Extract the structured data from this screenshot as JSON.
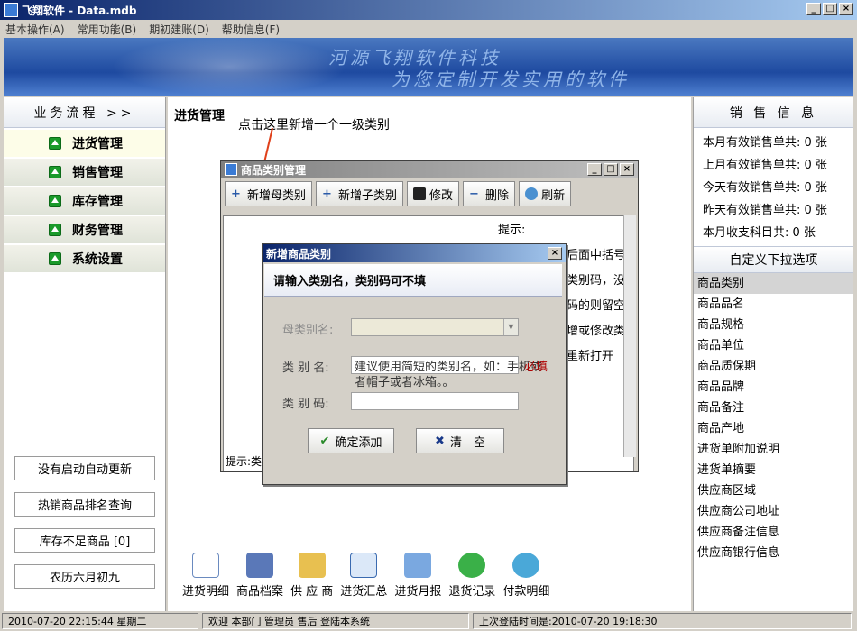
{
  "window": {
    "title": "飞翔软件 - Data.mdb"
  },
  "menu": [
    "基本操作(A)",
    "常用功能(B)",
    "期初建账(D)",
    "帮助信息(F)"
  ],
  "banner": {
    "line1": "河源飞翔软件科技",
    "line2": "为您定制开发实用的软件"
  },
  "left": {
    "flow_title": "业务流程  >>",
    "nav": [
      "进货管理",
      "销售管理",
      "库存管理",
      "财务管理",
      "系统设置"
    ],
    "buttons": [
      "没有启动自动更新",
      "热销商品排名查询",
      "库存不足商品 [0]",
      "农历六月初九"
    ]
  },
  "center": {
    "section_title": "进货管理",
    "annotation": "点击这里新增一个一级类别"
  },
  "category_window": {
    "title": "商品类别管理",
    "toolbar": [
      "新增母类别",
      "新增子类别",
      "修改",
      "删除",
      "刷新"
    ],
    "tips": [
      "提示:",
      "后面中括号",
      "类别码，没",
      "码的则留空",
      "增或修改类",
      "重新打开"
    ],
    "status": "提示:类"
  },
  "add_dialog": {
    "title": "新增商品类别",
    "header": "请输入类别名，类别码可不填",
    "parent_label": "母类别名:",
    "name_label": "类 别 名:",
    "code_label": "类 别 码:",
    "name_placeholder": "建议使用简短的类别名，如：手机或者帽子或者冰箱。。",
    "required": "必填",
    "confirm": "确定添加",
    "clear": "清　空"
  },
  "bottom_tools": [
    "进货明细",
    "商品档案",
    "供 应 商",
    "进货汇总",
    "进货月报",
    "退货记录",
    "付款明细"
  ],
  "right": {
    "sales_title": "销 售 信 息",
    "sales": [
      "本月有效销售单共: 0 张",
      "上月有效销售单共: 0 张",
      "今天有效销售单共: 0 张",
      "昨天有效销售单共: 0 张",
      "本月收支科目共: 0 张"
    ],
    "custom_title": "自定义下拉选项",
    "options": [
      "商品类别",
      "商品品名",
      "商品规格",
      "商品单位",
      "商品质保期",
      "商品品牌",
      "商品备注",
      "商品产地",
      "进货单附加说明",
      "进货单摘要",
      "供应商区域",
      "供应商公司地址",
      "供应商备注信息",
      "供应商银行信息"
    ],
    "selected_index": 0
  },
  "status": {
    "datetime": "2010-07-20 22:15:44  星期二",
    "welcome": "欢迎 本部门 管理员 售后 登陆本系统",
    "last_login_label": "上次登陆时间是:",
    "last_login": "2010-07-20 19:18:30"
  }
}
